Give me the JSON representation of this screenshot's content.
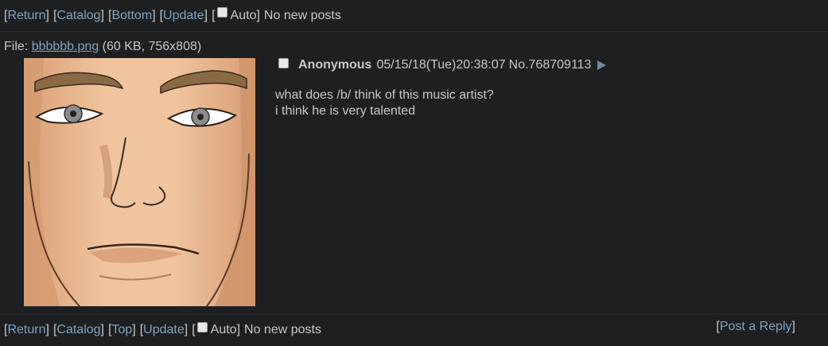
{
  "nav": {
    "return": "Return",
    "catalog": "Catalog",
    "bottom": "Bottom",
    "top": "Top",
    "update": "Update",
    "auto": "Auto",
    "status": "No new posts",
    "post_reply": "Post a Reply"
  },
  "file": {
    "label": "File:",
    "name": "bbbbbb.png",
    "meta": "(60 KB, 756x808)"
  },
  "post": {
    "name": "Anonymous",
    "datetime": "05/15/18(Tue)20:38:07",
    "number": "No.768709113",
    "message_line1": "what does /b/ think of this music artist?",
    "message_line2": "i think he is very talented"
  },
  "colors": {
    "background": "#1d1f21",
    "text": "#c5c8c6",
    "link": "#81a2be"
  }
}
